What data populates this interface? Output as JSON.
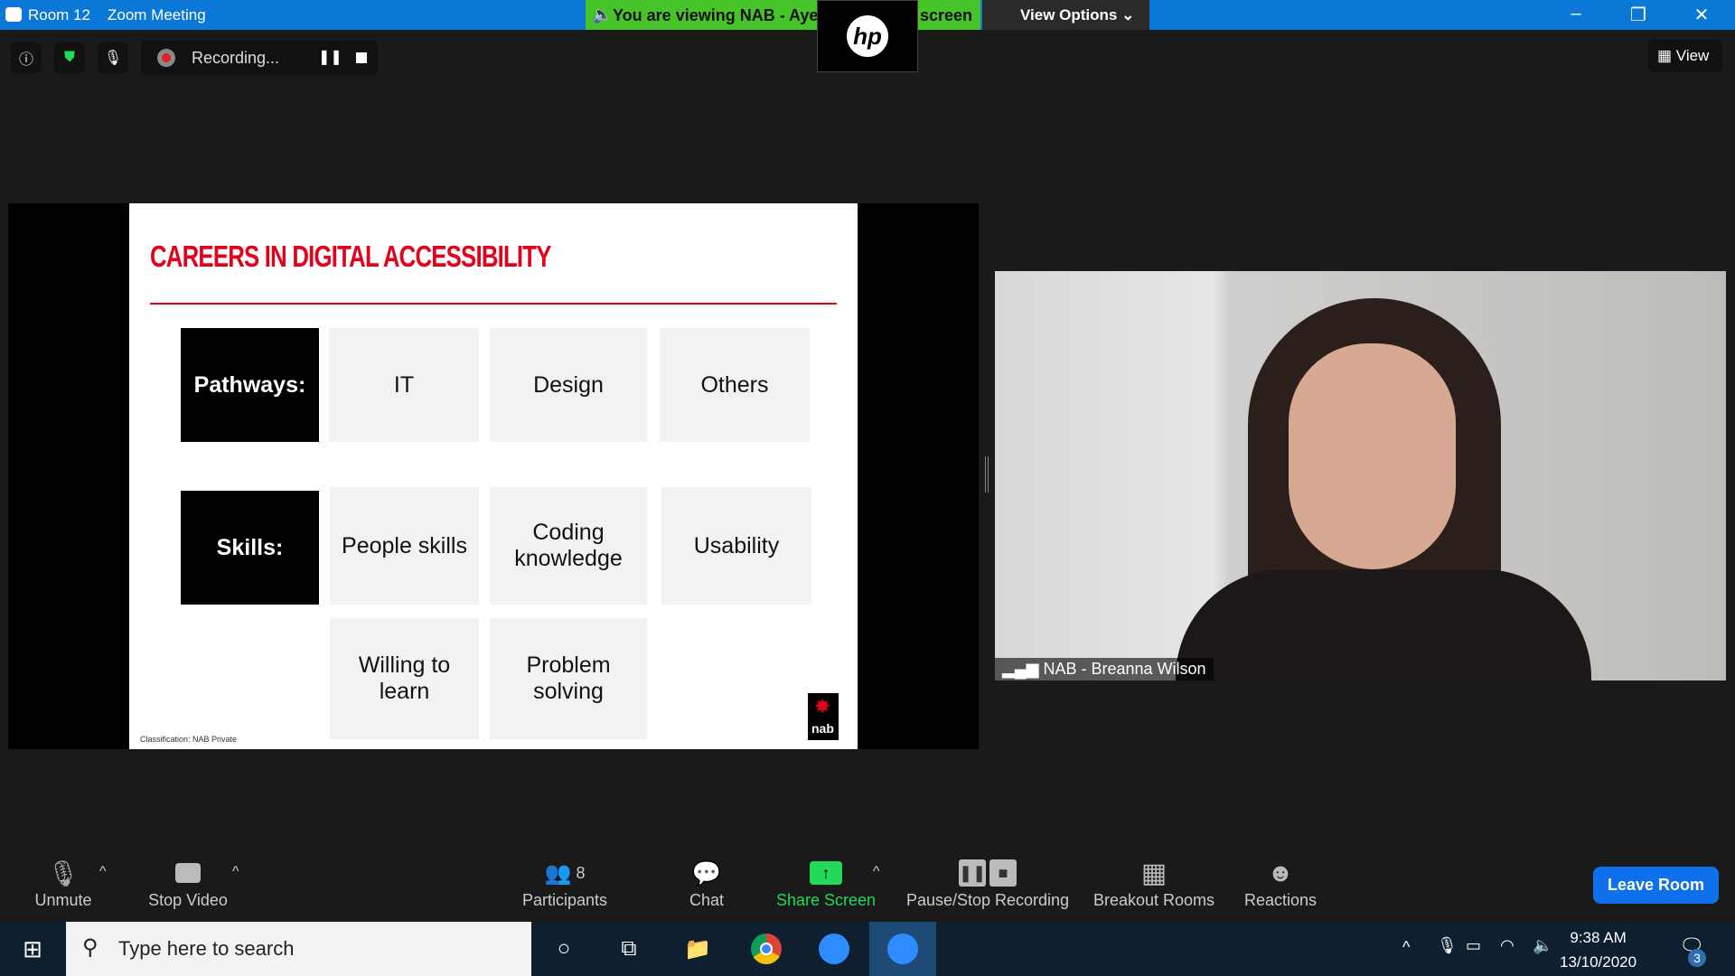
{
  "window": {
    "room": "Room 12",
    "app": "Zoom Meeting",
    "viewing_banner": "You are viewing NAB - Aye",
    "viewing_banner_tail": "screen",
    "view_options": "View Options",
    "hp_logo": "hp"
  },
  "top_toolbar": {
    "recording_label": "Recording...",
    "view_label": "View"
  },
  "slide": {
    "title": "CAREERS IN DIGITAL ACCESSIBILITY",
    "pathways_label": "Pathways:",
    "pathways": [
      "IT",
      "Design",
      "Others"
    ],
    "skills_label": "Skills:",
    "skills": [
      "People skills",
      "Coding knowledge",
      "Usability",
      "Willing to learn",
      "Problem solving"
    ],
    "classification": "Classification: NAB Private",
    "logo_text": "nab",
    "accent": "#e4001b"
  },
  "video": {
    "participant_name": "NAB - Breanna Wilson"
  },
  "toolbar": {
    "unmute": "Unmute",
    "stop_video": "Stop Video",
    "participants": "Participants",
    "participants_count": "8",
    "chat": "Chat",
    "share_screen": "Share Screen",
    "pause_stop_recording": "Pause/Stop Recording",
    "breakout_rooms": "Breakout Rooms",
    "reactions": "Reactions",
    "leave": "Leave Room",
    "share_color": "#23d959",
    "leave_color": "#0e71eb"
  },
  "taskbar": {
    "search_placeholder": "Type here to search",
    "time": "9:38 AM",
    "date": "13/10/2020",
    "notification_count": "3"
  }
}
